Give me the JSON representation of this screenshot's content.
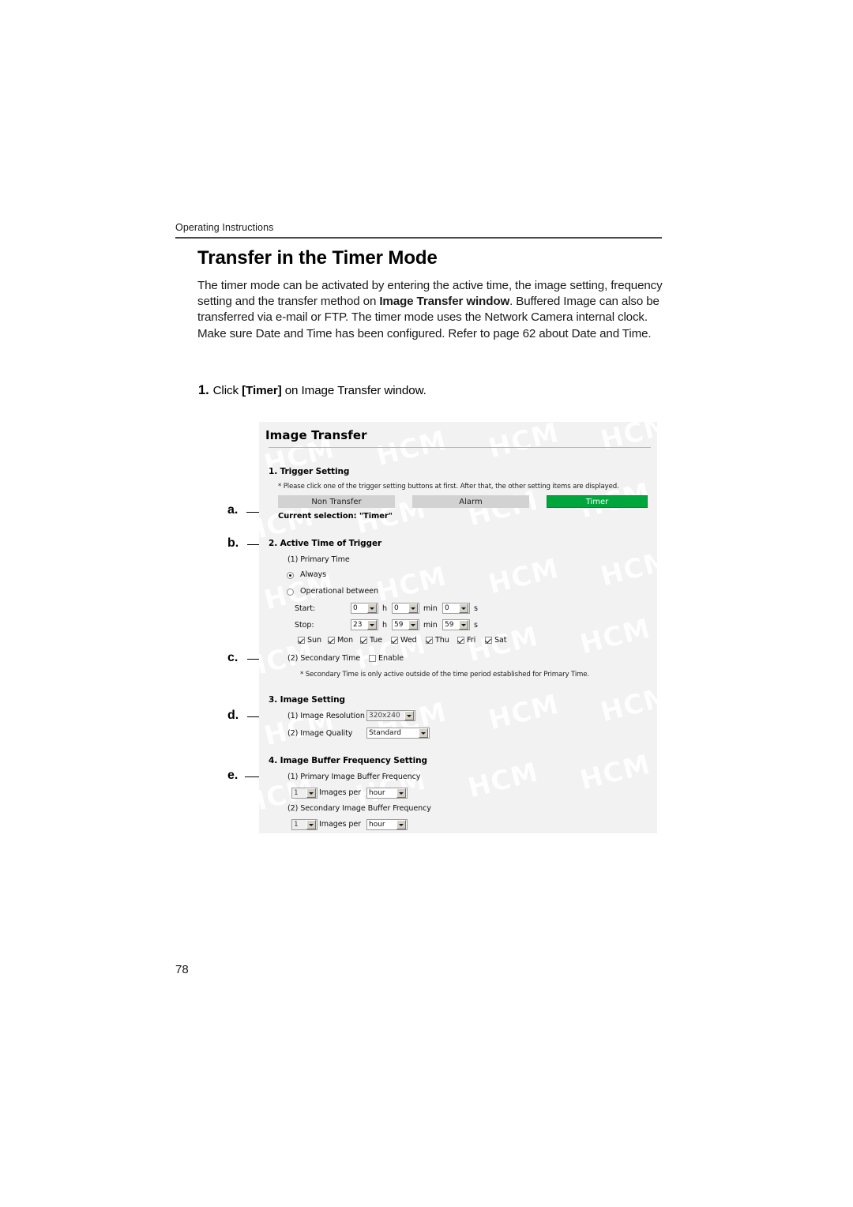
{
  "page": {
    "header": "Operating Instructions",
    "title": "Transfer in the Timer Mode",
    "body_part1": "The timer mode can be activated by entering the active time, the image setting, frequency setting and the transfer method on ",
    "body_bold": "Image Transfer window",
    "body_part2": ". Buffered Image can also be transferred via e-mail or FTP. The timer mode uses the Network Camera internal clock. Make sure Date and Time has been configured. Refer to page 62 about Date and Time.",
    "step_number": "1.",
    "step_pre": "Click ",
    "step_kbd": "[Timer]",
    "step_post": " on Image Transfer window.",
    "page_number": "78"
  },
  "callouts": {
    "a": "a.",
    "b": "b.",
    "c": "c.",
    "d": "d.",
    "e": "e."
  },
  "screenshot": {
    "watermark": "HCM",
    "title": "Image Transfer",
    "trigger": {
      "heading": "1. Trigger Setting",
      "note": "* Please click one of the trigger setting buttons at first. After that, the other setting items are displayed.",
      "buttons": [
        {
          "label": "Non Transfer",
          "selected": false
        },
        {
          "label": "Alarm",
          "selected": false
        },
        {
          "label": "Timer",
          "selected": true
        }
      ],
      "current_selection": "Current selection: \"Timer\"",
      "selected_color": "#00a63c"
    },
    "active_time": {
      "heading": "2. Active Time of Trigger",
      "primary_label": "(1) Primary Time",
      "radio_always": "Always",
      "radio_operational": "Operational between",
      "radio_selected": "Always",
      "start_label": "Start:",
      "stop_label": "Stop:",
      "unit_h": "h",
      "unit_min": "min",
      "unit_s": "s",
      "start": {
        "hour": "0",
        "minute": "0",
        "second": "0"
      },
      "stop": {
        "hour": "23",
        "minute": "59",
        "second": "59"
      },
      "days": [
        {
          "label": "Sun",
          "checked": true
        },
        {
          "label": "Mon",
          "checked": true
        },
        {
          "label": "Tue",
          "checked": true
        },
        {
          "label": "Wed",
          "checked": true
        },
        {
          "label": "Thu",
          "checked": true
        },
        {
          "label": "Fri",
          "checked": true
        },
        {
          "label": "Sat",
          "checked": true
        }
      ],
      "secondary_label": "(2) Secondary Time",
      "secondary_enable_label": "Enable",
      "secondary_enable_checked": false,
      "secondary_note": "* Secondary Time is only active outside of the time period established for Primary Time."
    },
    "image_setting": {
      "heading": "3. Image Setting",
      "resolution_label": "(1) Image Resolution",
      "resolution_value": "320x240",
      "quality_label": "(2) Image Quality",
      "quality_value": "Standard"
    },
    "buffer_frequency": {
      "heading": "4. Image Buffer Frequency Setting",
      "primary_label": "(1) Primary Image Buffer Frequency",
      "primary_count": "1",
      "primary_images_per": "Images per",
      "primary_unit": "hour",
      "secondary_label": "(2) Secondary Image Buffer Frequency",
      "secondary_count": "1",
      "secondary_images_per": "Images per",
      "secondary_unit": "hour"
    }
  }
}
